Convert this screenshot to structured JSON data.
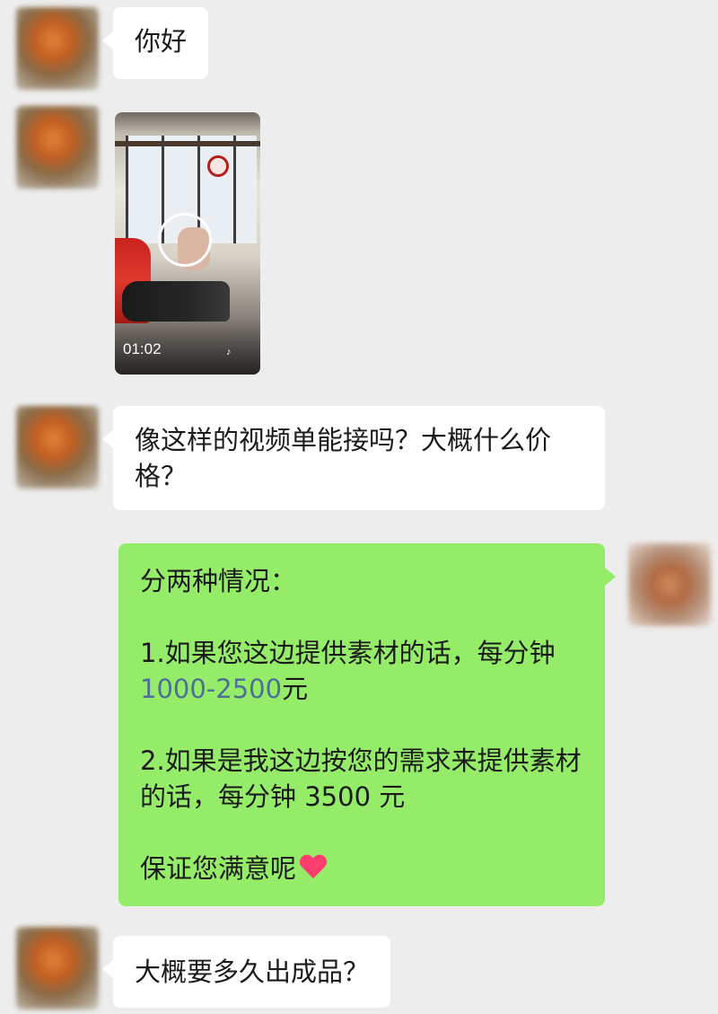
{
  "messages": [
    {
      "sender": "other",
      "type": "text",
      "text": "你好"
    },
    {
      "sender": "other",
      "type": "video",
      "duration": "01:02"
    },
    {
      "sender": "other",
      "type": "text",
      "text": "像这样的视频单能接吗？大概什么价格？"
    },
    {
      "sender": "me",
      "type": "text",
      "intro": "分两种情况：",
      "option1_prefix": "1.如果您这边提供素材的话，每分钟",
      "option1_price": "1000-2500",
      "option1_suffix": "元",
      "option2": "2.如果是我这边按您的需求来提供素材的话，每分钟 3500 元",
      "closing": "保证您满意呢"
    },
    {
      "sender": "other",
      "type": "text",
      "text": "大概要多久出成品？"
    }
  ],
  "icons": {
    "heart": "heart-emoji-icon",
    "tiktok": "tiktok-icon"
  },
  "colors": {
    "background": "#ededed",
    "incoming_bubble": "#ffffff",
    "outgoing_bubble": "#95ec69",
    "link_number": "#4e6f96",
    "heart": "#ff3d6e"
  }
}
